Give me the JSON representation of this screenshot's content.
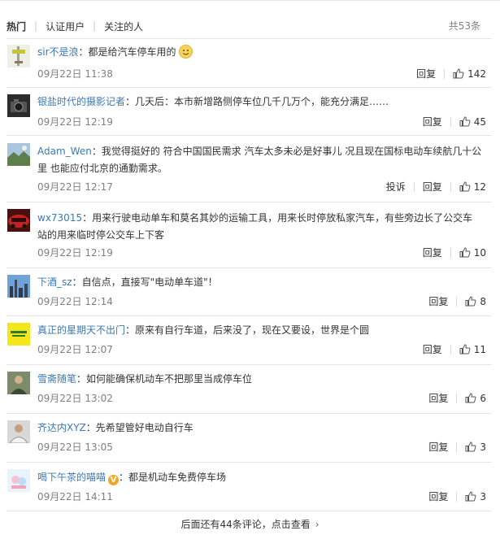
{
  "tabs": [
    {
      "label": "热门",
      "active": true
    },
    {
      "label": "认证用户",
      "active": false
    },
    {
      "label": "关注的人",
      "active": false
    }
  ],
  "count_label": "共53条",
  "actions": {
    "reply": "回复",
    "report": "投诉"
  },
  "comments": [
    {
      "user": "sir不是浪",
      "sep": "：",
      "text": "都是给汽车停车用的",
      "time": "09月22日 11:38",
      "likes": "142",
      "avatar_icon": "pole-icon",
      "emoji": "smile-emoji"
    },
    {
      "user": "银盐时代的摄影记者",
      "sep": "：",
      "text": "几天后：本市新增路侧停车位几千几万个，能充分满足……",
      "time": "09月22日 12:19",
      "likes": "45",
      "avatar_icon": "camera-icon"
    },
    {
      "user": "Adam_Wen",
      "sep": "：",
      "text": "我觉得挺好的 符合中国国民需求 汽车太多未必是好事儿 况且现在国标电动车续航几十公里 也能应付北京的通勤需求。",
      "time": "09月22日 12:17",
      "likes": "12",
      "avatar_icon": "landscape-icon",
      "report": true
    },
    {
      "user": "wx73015",
      "sep": "：",
      "text": "用来行驶电动单车和莫名其妙的运输工具，用来长时停放私家汽车，有些旁边长了公交车站的用来临时停公交车上下客",
      "time": "09月22日 12:19",
      "likes": "10",
      "avatar_icon": "car-icon"
    },
    {
      "user": "下酒_sz",
      "sep": "：",
      "text": "自信点，直接写\"电动单车道\"！",
      "time": "09月22日 12:14",
      "likes": "8",
      "avatar_icon": "skyline-icon"
    },
    {
      "user": "真正的星期天不出门",
      "sep": "：",
      "text": "原来有自行车道，后来没了，现在又要设，世界是个圆",
      "time": "09月22日 12:07",
      "likes": "11",
      "avatar_icon": "yellow-logo-icon"
    },
    {
      "user": "雪斋随笔",
      "sep": "：",
      "text": "如何能确保机动车不把那里当成停车位",
      "time": "09月22日 13:02",
      "likes": "6",
      "avatar_icon": "person-icon"
    },
    {
      "user": "齐达内XYZ",
      "sep": "：",
      "text": "先希望管好电动自行车",
      "time": "09月22日 13:05",
      "likes": "3",
      "avatar_icon": "footballer-icon"
    },
    {
      "user": "喝下午茶的喵喵",
      "sep": "：",
      "text": "都是机动车免费停车场",
      "time": "09月22日 14:11",
      "likes": "3",
      "avatar_icon": "cartoon-icon",
      "verified": true
    }
  ],
  "more_label": "后面还有44条评论，点击查看",
  "colors": {
    "username": "#3a79b6",
    "time": "#808080",
    "verified_badge": "#f5a623"
  }
}
